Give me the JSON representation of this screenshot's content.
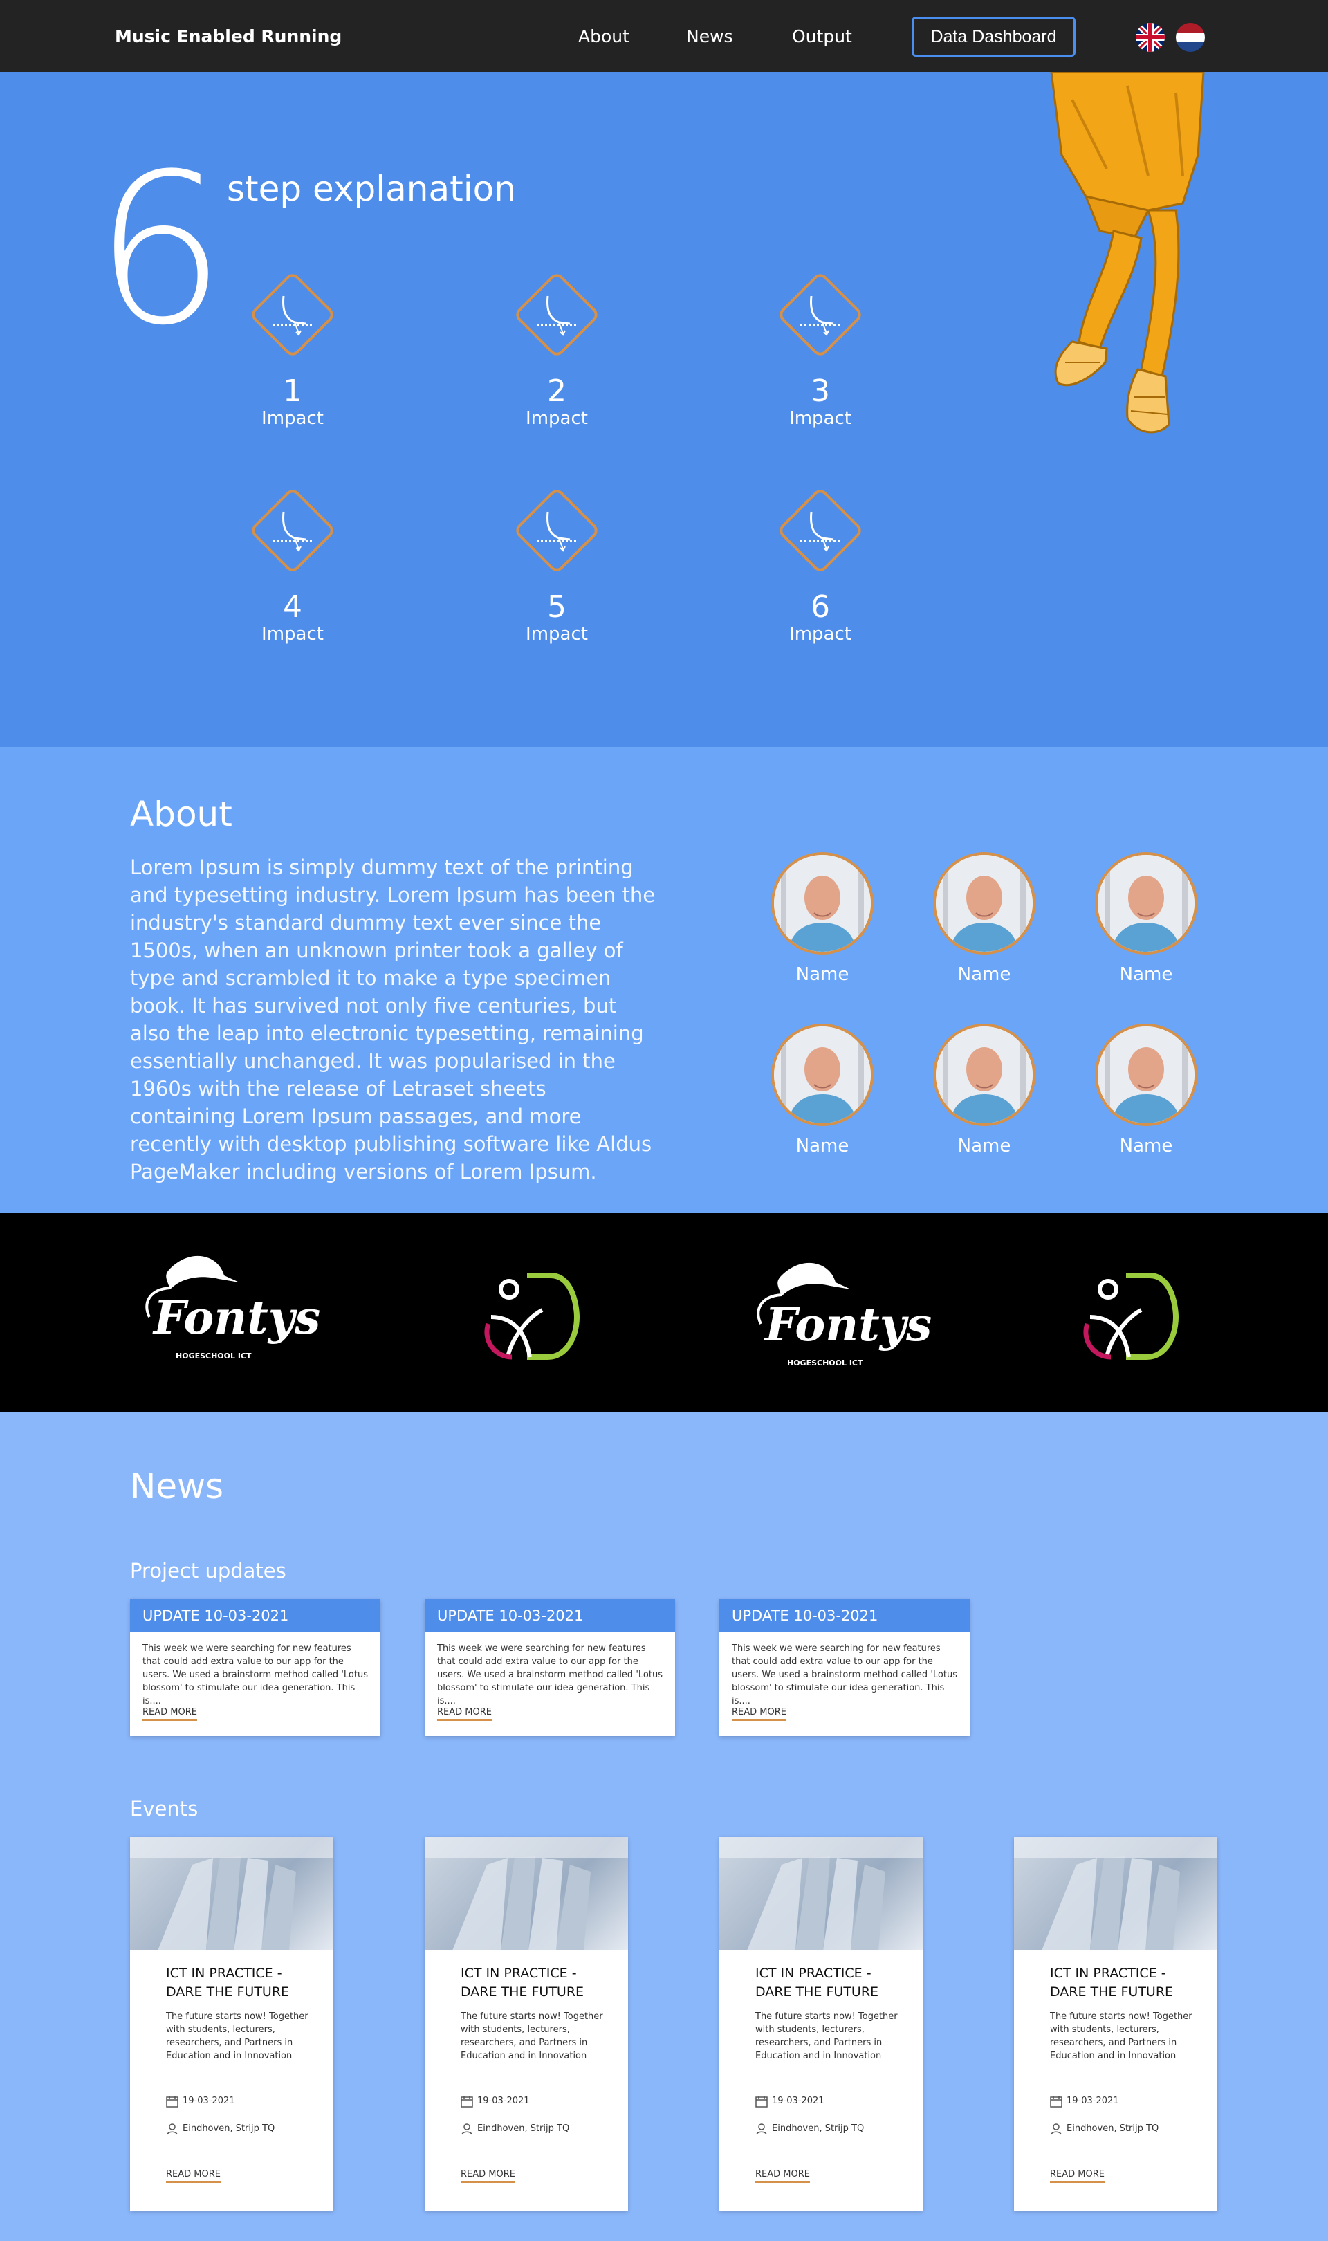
{
  "nav": {
    "brand": "Music Enabled Running",
    "links": [
      "About",
      "News",
      "Output"
    ],
    "dashboard_label": "Data Dashboard",
    "languages": [
      "uk-flag-icon",
      "nl-flag-icon"
    ]
  },
  "hero": {
    "big_number": "6",
    "title": "step explanation",
    "steps": [
      {
        "num": "1",
        "label": "Impact"
      },
      {
        "num": "2",
        "label": "Impact"
      },
      {
        "num": "3",
        "label": "Impact"
      },
      {
        "num": "4",
        "label": "Impact"
      },
      {
        "num": "5",
        "label": "Impact"
      },
      {
        "num": "6",
        "label": "Impact"
      }
    ]
  },
  "about": {
    "title": "About",
    "body": "Lorem Ipsum is simply dummy text of the printing and typesetting industry. Lorem Ipsum has been the industry's standard dummy text ever since the 1500s, when an unknown printer took a galley of type and scrambled it to make a type specimen book. It has survived not only five centuries, but also the leap into electronic typesetting, remaining essentially unchanged. It was popularised in the 1960s with the release of Letraset sheets containing Lorem Ipsum passages, and more recently with desktop publishing software like Aldus PageMaker including versions of Lorem Ipsum.",
    "team": [
      "Name",
      "Name",
      "Name",
      "Name",
      "Name",
      "Name"
    ]
  },
  "partners": {
    "fontys_word": "Fontys",
    "fontys_sub": "HOGESCHOOL ICT"
  },
  "news": {
    "title": "News",
    "updates_title": "Project updates",
    "updates": [
      {
        "head": "UPDATE 10-03-2021",
        "text": "This week we were searching for new features that could add extra value to our app for the users. We used a brainstorm method called 'Lotus blossom' to stimulate our idea generation. This is....",
        "link": "READ MORE"
      },
      {
        "head": "UPDATE 10-03-2021",
        "text": "This week we were searching for new features that could add extra value to our app for the users. We used a brainstorm method called 'Lotus blossom' to stimulate our idea generation. This is....",
        "link": "READ MORE"
      },
      {
        "head": "UPDATE 10-03-2021",
        "text": "This week we were searching for new features that could add extra value to our app for the users. We used a brainstorm method called 'Lotus blossom' to stimulate our idea generation. This is....",
        "link": "READ MORE"
      }
    ],
    "events_title": "Events",
    "events": [
      {
        "title": "ICT IN PRACTICE - DARE THE FUTURE",
        "desc": "The future starts now! Together with students, lecturers, researchers, and Partners in Education and in Innovation",
        "date": "19-03-2021",
        "location": "Eindhoven, Strijp TQ",
        "link": "READ MORE"
      },
      {
        "title": "ICT IN PRACTICE - DARE THE FUTURE",
        "desc": "The future starts now! Together with students, lecturers, researchers, and Partners in Education and in Innovation",
        "date": "19-03-2021",
        "location": "Eindhoven, Strijp TQ",
        "link": "READ MORE"
      },
      {
        "title": "ICT IN PRACTICE - DARE THE FUTURE",
        "desc": "The future starts now! Together with students, lecturers, researchers, and Partners in Education and in Innovation",
        "date": "19-03-2021",
        "location": "Eindhoven, Strijp TQ",
        "link": "READ MORE"
      },
      {
        "title": "ICT IN PRACTICE - DARE THE FUTURE",
        "desc": "The future starts now! Together with students, lecturers, researchers, and Partners in Education and in Innovation",
        "date": "19-03-2021",
        "location": "Eindhoven, Strijp TQ",
        "link": "READ MORE"
      }
    ]
  },
  "colors": {
    "nav_bg": "#232323",
    "hero_bg": "#4e8de9",
    "about_bg": "#6aa5f7",
    "news_bg": "#8ab6fa",
    "accent_orange": "#d59049"
  }
}
